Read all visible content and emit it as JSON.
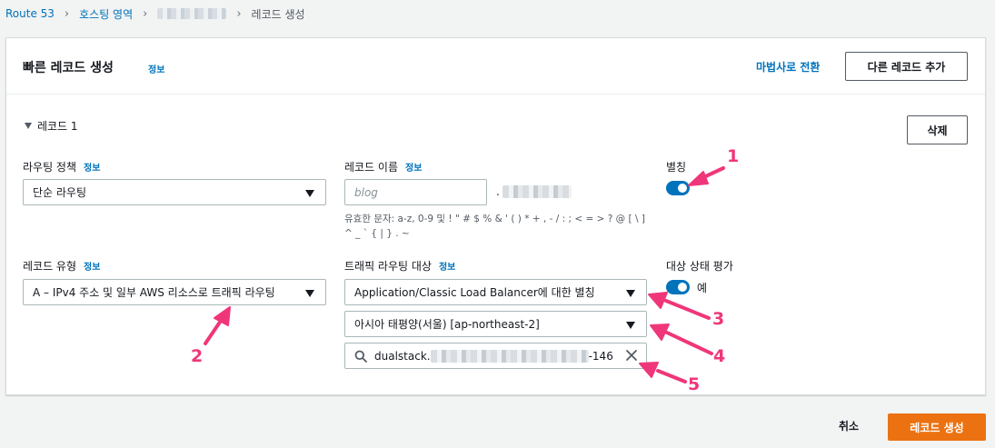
{
  "breadcrumb": {
    "items": [
      "Route 53",
      "호스팅 영역"
    ],
    "current": "레코드 생성"
  },
  "panel": {
    "title": "빠른 레코드 생성",
    "info": "정보",
    "wizard_link": "마법사로 전환",
    "add_button": "다른 레코드 추가"
  },
  "record": {
    "toggle_label": "레코드 1",
    "delete_button": "삭제",
    "routing_policy": {
      "label": "라우팅 정책",
      "info": "정보",
      "value": "단순 라우팅"
    },
    "record_name": {
      "label": "레코드 이름",
      "info": "정보",
      "placeholder": "blog",
      "suffix_dot": ".",
      "help": "유효한 문자: a-z, 0-9 및 ! \" # $ % & ' ( ) * + , - / : ; < = > ? @ [ \\ ] ^ _ ` { | } . ~"
    },
    "alias": {
      "label": "별칭",
      "enabled": true
    },
    "record_type": {
      "label": "레코드 유형",
      "info": "정보",
      "value": "A – IPv4 주소 및 일부 AWS 리소스로 트래픽 라우팅"
    },
    "traffic_target": {
      "label": "트래픽 라우팅 대상",
      "info": "정보",
      "endpoint": "Application/Classic Load Balancer에 대한 별칭",
      "region": "아시아 태평양(서울) [ap-northeast-2]",
      "search_prefix": "dualstack.",
      "search_suffix": "-146"
    },
    "health": {
      "label": "대상 상태 평가",
      "toggle_text": "예",
      "enabled": true
    }
  },
  "footer": {
    "cancel": "취소",
    "create": "레코드 생성"
  },
  "annotations": {
    "labels": [
      "1",
      "2",
      "3",
      "4",
      "5"
    ],
    "color": "#f0367a"
  },
  "colors": {
    "link": "#0073bb",
    "primary": "#ec7211",
    "toggle": "#0073bb",
    "annotation": "#f0367a"
  }
}
